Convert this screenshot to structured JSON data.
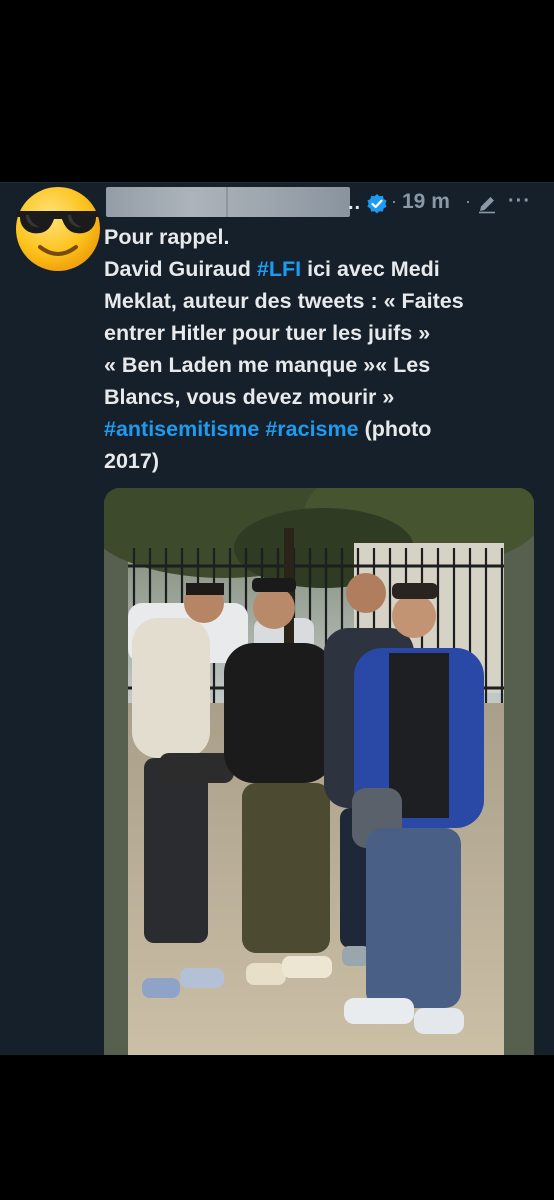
{
  "tweet": {
    "name_truncation": "..",
    "time": "19 m",
    "separator": "·",
    "more": "···",
    "text": {
      "line1": "Pour rappel.",
      "line2a": "David Guiraud ",
      "hashtag_lfi": "#LFI",
      "line2b": " ici avec Medi",
      "line3": "Meklat, auteur des tweets : « Faites",
      "line4": "entrer Hitler pour tuer les juifs »",
      "line5": "« Ben Laden me manque »« Les",
      "line6": "Blancs, vous devez mourir »",
      "hashtag_antisemitisme": "#antisemitisme",
      "space": " ",
      "hashtag_racisme": "#racisme",
      "line7b": " (photo",
      "line8": "2017)"
    }
  },
  "icons": {
    "avatar": "sunglasses-emoji-icon",
    "verified": "verified-badge-icon",
    "edit": "edit-pencil-icon",
    "more": "more-options-icon"
  },
  "colors": {
    "background": "#15202b",
    "text": "#e7e9ea",
    "secondary": "#8b98a5",
    "link": "#1d9bf0"
  }
}
